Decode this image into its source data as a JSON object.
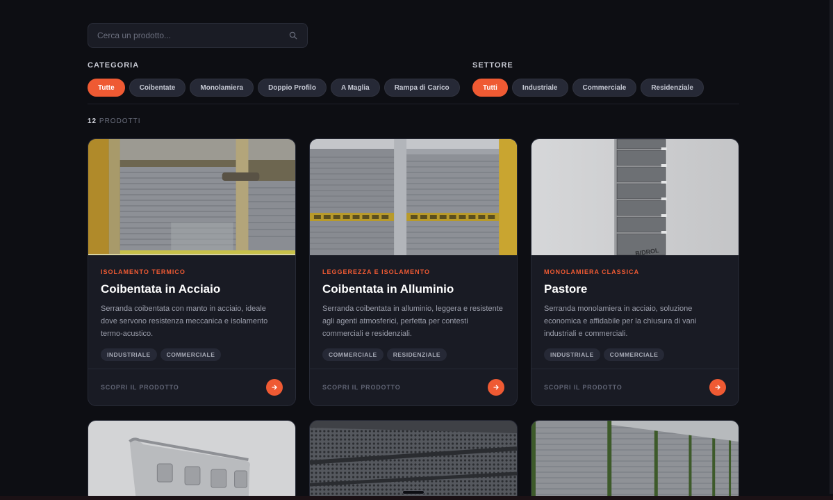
{
  "search": {
    "placeholder": "Cerca un prodotto...",
    "icon": "search-icon"
  },
  "filters": {
    "categoria": {
      "label": "CATEGORIA",
      "options": [
        "Tutte",
        "Coibentate",
        "Monolamiera",
        "Doppio Profilo",
        "A Maglia",
        "Rampa di Carico"
      ],
      "selected": "Tutte"
    },
    "settore": {
      "label": "SETTORE",
      "options": [
        "Tutti",
        "Industriale",
        "Commerciale",
        "Residenziale"
      ],
      "selected": "Tutti"
    }
  },
  "results": {
    "count": "12",
    "label": "PRODOTTI"
  },
  "products": [
    {
      "eyebrow": "ISOLAMENTO TERMICO",
      "title": "Coibentata in Acciaio",
      "description": "Serranda coibentata con manto in acciaio, ideale dove servono resistenza meccanica e isolamento termo-acustico.",
      "tags": [
        "INDUSTRIALE",
        "COMMERCIALE"
      ],
      "cta": "SCOPRI IL PRODOTTO"
    },
    {
      "eyebrow": "LEGGEREZZA E ISOLAMENTO",
      "title": "Coibentata in Alluminio",
      "description": "Serranda coibentata in alluminio, leggera e resistente agli agenti atmosferici, perfetta per contesti commerciali e residenziali.",
      "tags": [
        "COMMERCIALE",
        "RESIDENZIALE"
      ],
      "cta": "SCOPRI IL PRODOTTO"
    },
    {
      "eyebrow": "MONOLAMIERA CLASSICA",
      "title": "Pastore",
      "description": "Serranda monolamiera in acciaio, soluzione economica e affidabile per la chiusura di vani industriali e commerciali.",
      "tags": [
        "INDUSTRIALE",
        "COMMERCIALE"
      ],
      "cta": "SCOPRI IL PRODOTTO"
    }
  ],
  "image_labels": {
    "slat_brand": "BIDROL"
  },
  "colors": {
    "accent": "#ef5a33",
    "background": "#0d0e13",
    "card": "#191b24"
  }
}
